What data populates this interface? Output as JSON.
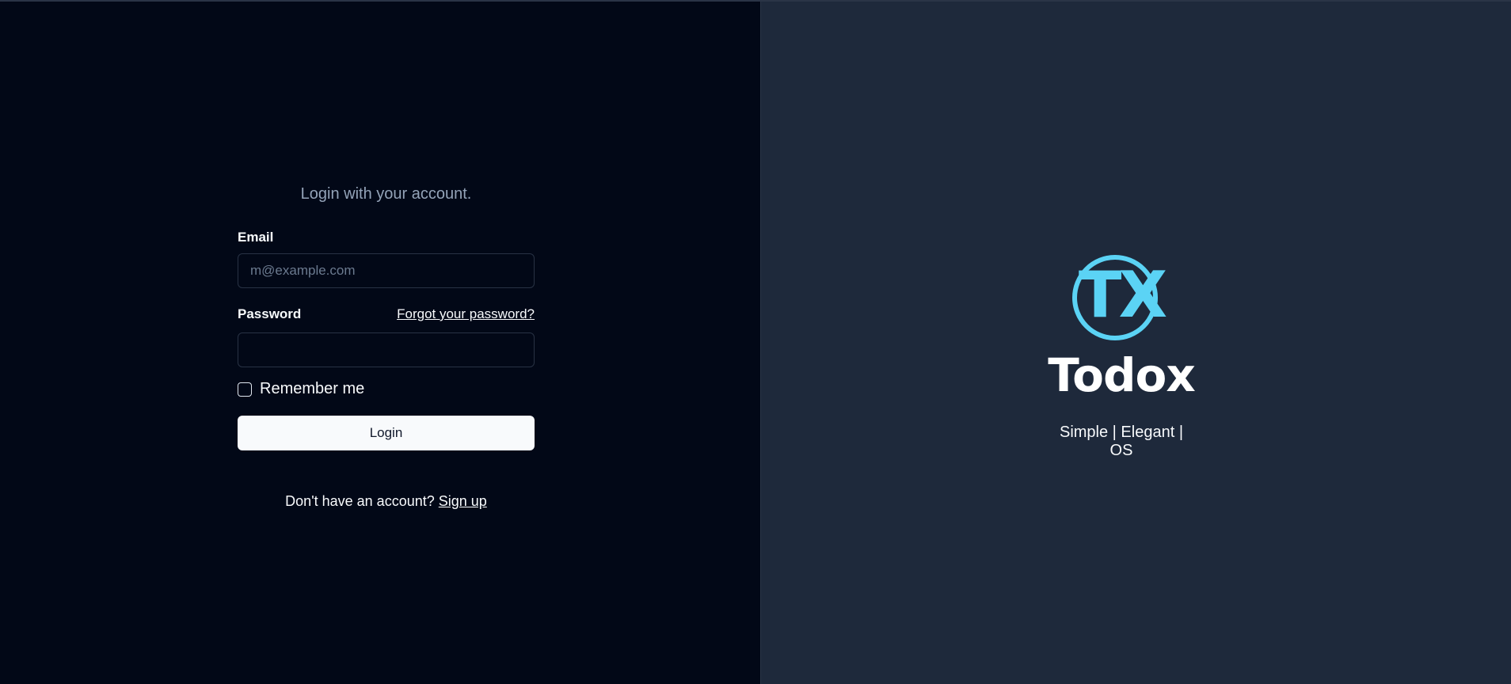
{
  "login": {
    "subtitle": "Login with your account.",
    "email_label": "Email",
    "email_placeholder": "m@example.com",
    "email_value": "",
    "password_label": "Password",
    "password_value": "",
    "forgot_link": "Forgot your password?",
    "remember_label": "Remember me",
    "remember_checked": false,
    "login_button": "Login",
    "signup_prompt": "Don't have an account?",
    "signup_link": "Sign up"
  },
  "brand": {
    "logo_text": "TX",
    "name": "Todox",
    "tagline": "Simple | Elegant | OS",
    "logo_icon": "tx-circle-logo-icon"
  },
  "colors": {
    "left_background": "#020817",
    "right_background": "#1e293b",
    "accent": "#5bd3f5",
    "text": "#f8fafc",
    "muted": "#94a3b8"
  }
}
